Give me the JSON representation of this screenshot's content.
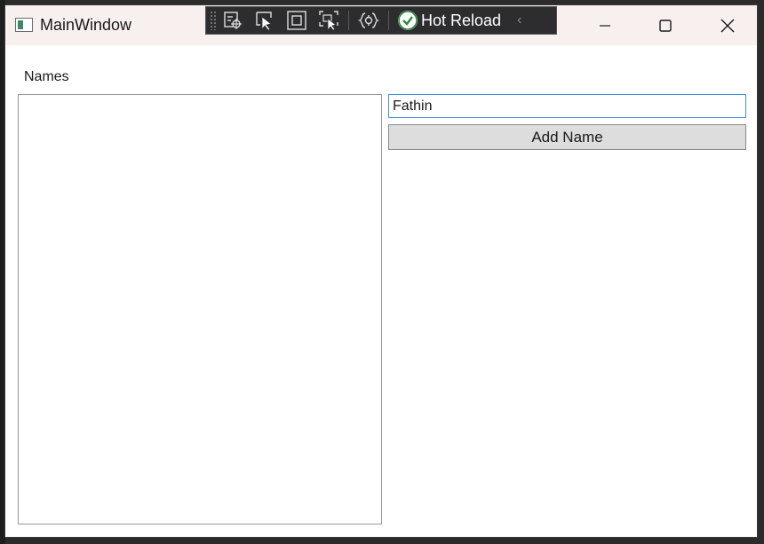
{
  "window": {
    "title": "MainWindow"
  },
  "debug_toolbar": {
    "buttons": [
      "live-visual-tree-icon",
      "select-element-icon",
      "display-layout-adorners-icon",
      "track-focused-element-icon",
      "binding-failures-icon"
    ],
    "hot_reload_label": "Hot Reload"
  },
  "main": {
    "names_label": "Names",
    "name_input_value": "Fathin",
    "add_button_label": "Add Name",
    "names_list": []
  },
  "colors": {
    "accent_focus": "#3a8ee6",
    "button_bg": "#dddddd",
    "titlebar_bg": "#f8f0ee",
    "toolbar_bg": "#2d2d30"
  }
}
